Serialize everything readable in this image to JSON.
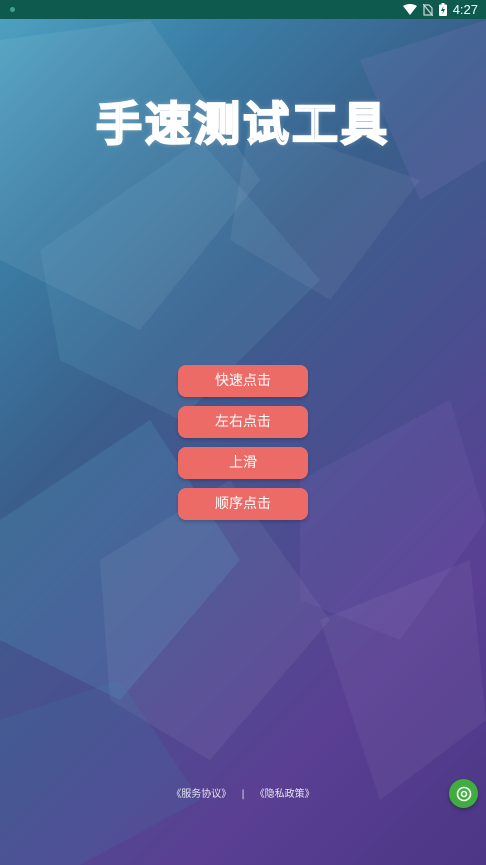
{
  "status_bar": {
    "time": "4:27"
  },
  "app": {
    "title": "手速测试工具"
  },
  "menu": {
    "buttons": [
      {
        "label": "快速点击"
      },
      {
        "label": "左右点击"
      },
      {
        "label": "上滑"
      },
      {
        "label": "顺序点击"
      }
    ]
  },
  "footer": {
    "service_agreement": "《服务协议》",
    "separator": "|",
    "privacy_policy": "《隐私政策》"
  },
  "floating_button": {
    "icon": "target-icon",
    "color": "#3fae3f"
  },
  "colors": {
    "button": "#ec6b67",
    "status_bar": "#0e5a4e"
  }
}
